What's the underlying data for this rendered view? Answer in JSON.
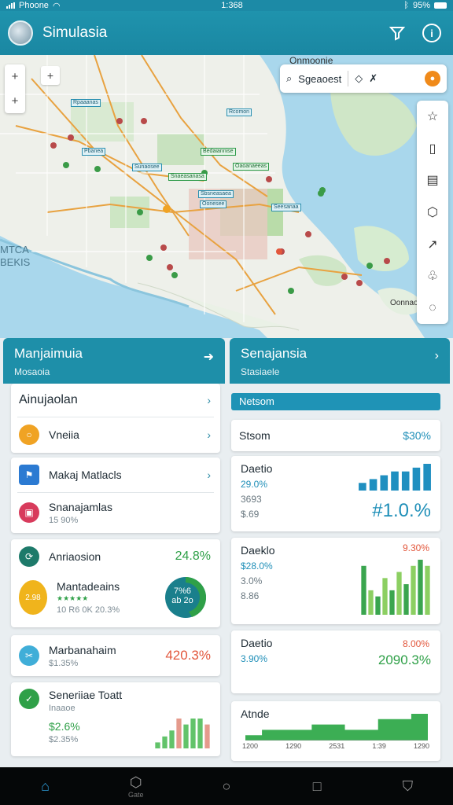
{
  "status": {
    "carrier": "Phoone",
    "time": "1:368",
    "battery": "95%"
  },
  "appbar": {
    "title": "Simulasia",
    "filter_icon": "funnel-icon",
    "info_icon": "info-icon"
  },
  "map": {
    "search_label": "Sgeaoest",
    "top_right_label": "Onmoonie",
    "side_label_1": "MTCA",
    "side_label_2": "BEKIS",
    "bottom_right_label": "Oonnao",
    "zoom_in": "+",
    "zoom_out": "-",
    "tools": [
      "star-icon",
      "book-icon",
      "clipboard-icon",
      "hexagon-icon",
      "route-icon",
      "puzzle-icon",
      "leaf-icon"
    ],
    "district_chips": [
      "Rpaaanas",
      "Pbanea",
      "Sunaosee",
      "Snaeasanasa",
      "Bedaiannise",
      "Oaoanaeeas",
      "Sbsneasaea",
      "Oonesee",
      "Seesanaa",
      "Rcomon"
    ]
  },
  "left_panel": {
    "title": "Manjaimuia",
    "subtitle": "Mosaoia",
    "nav_rows": [
      {
        "label": "Ainujaolan"
      },
      {
        "label": "Vneiia",
        "icon": "circle-icon",
        "color": "#f0a324"
      }
    ],
    "nav_rows_2": [
      {
        "label": "Makaj Matlacls",
        "icon": "flag-icon",
        "color": "#2b7ad2"
      },
      {
        "label": "Snanajamlas",
        "sub": "15 90%",
        "icon": "box-icon",
        "color": "#d83b5c"
      }
    ],
    "metric_card": {
      "label": "Anriaosion",
      "value": "24.8%",
      "item_label": "Mantadeains",
      "item_badge": "2.98",
      "item_stars": "★★★★★",
      "item_sub": "10 R6 0K 20.3%",
      "donut_value": "7%6",
      "donut_sub": "ab 2o"
    },
    "stat_card_1": {
      "label": "Marbanahaim",
      "sub": "$1.35%",
      "value": "420.3%"
    },
    "stat_card_2": {
      "label": "Seneriiae Toatt",
      "sub": "Inaaoe",
      "value_1": "$2.6%",
      "value_2": "$2.35%"
    },
    "colors": {
      "green": "#2fa048",
      "red": "#e2573c"
    }
  },
  "right_panel": {
    "title": "Senajansia",
    "subtitle": "Stasiaele",
    "strip": "Netsom",
    "row_1": {
      "label": "Stsom",
      "value": "$30%"
    },
    "card_1": {
      "title": "Daetio",
      "line_1": "29.0%",
      "line_2": "3693",
      "line_3": "$.69",
      "big": "#1.0.%"
    },
    "card_2": {
      "title": "Daeklo",
      "line_1": "$28.0%",
      "line_2": "3.0%",
      "line_3": "8.86",
      "top": "9.30%"
    },
    "card_3": {
      "title": "Daetio",
      "top": "8.00%",
      "line_1": "3.90%",
      "value": "2090.3%"
    },
    "card_4": {
      "title": "Atnde",
      "axis": [
        "1200",
        "1290",
        "2531",
        "1:39",
        "1290"
      ]
    }
  },
  "chart_data": [
    {
      "type": "bar",
      "series": [
        {
          "values": [
            2,
            3,
            4,
            5,
            5,
            6,
            7
          ]
        }
      ]
    },
    {
      "type": "bar",
      "series": [
        {
          "values": [
            8,
            4,
            3,
            6,
            4,
            7,
            5,
            8,
            9,
            8
          ]
        }
      ]
    },
    {
      "type": "area",
      "series": [
        {
          "values": [
            1,
            2,
            2,
            2,
            3,
            3,
            2,
            2,
            4,
            4,
            5
          ]
        }
      ]
    },
    {
      "type": "bar",
      "series": [
        {
          "values": [
            1,
            2,
            3,
            5,
            4,
            5,
            5,
            4
          ]
        }
      ]
    }
  ],
  "navbar": {
    "items": [
      {
        "icon": "home-icon",
        "label": ""
      },
      {
        "icon": "hexagon-icon",
        "label": "Gate"
      },
      {
        "icon": "circle-icon",
        "label": ""
      },
      {
        "icon": "square-icon",
        "label": ""
      },
      {
        "icon": "shield-icon",
        "label": ""
      }
    ]
  }
}
